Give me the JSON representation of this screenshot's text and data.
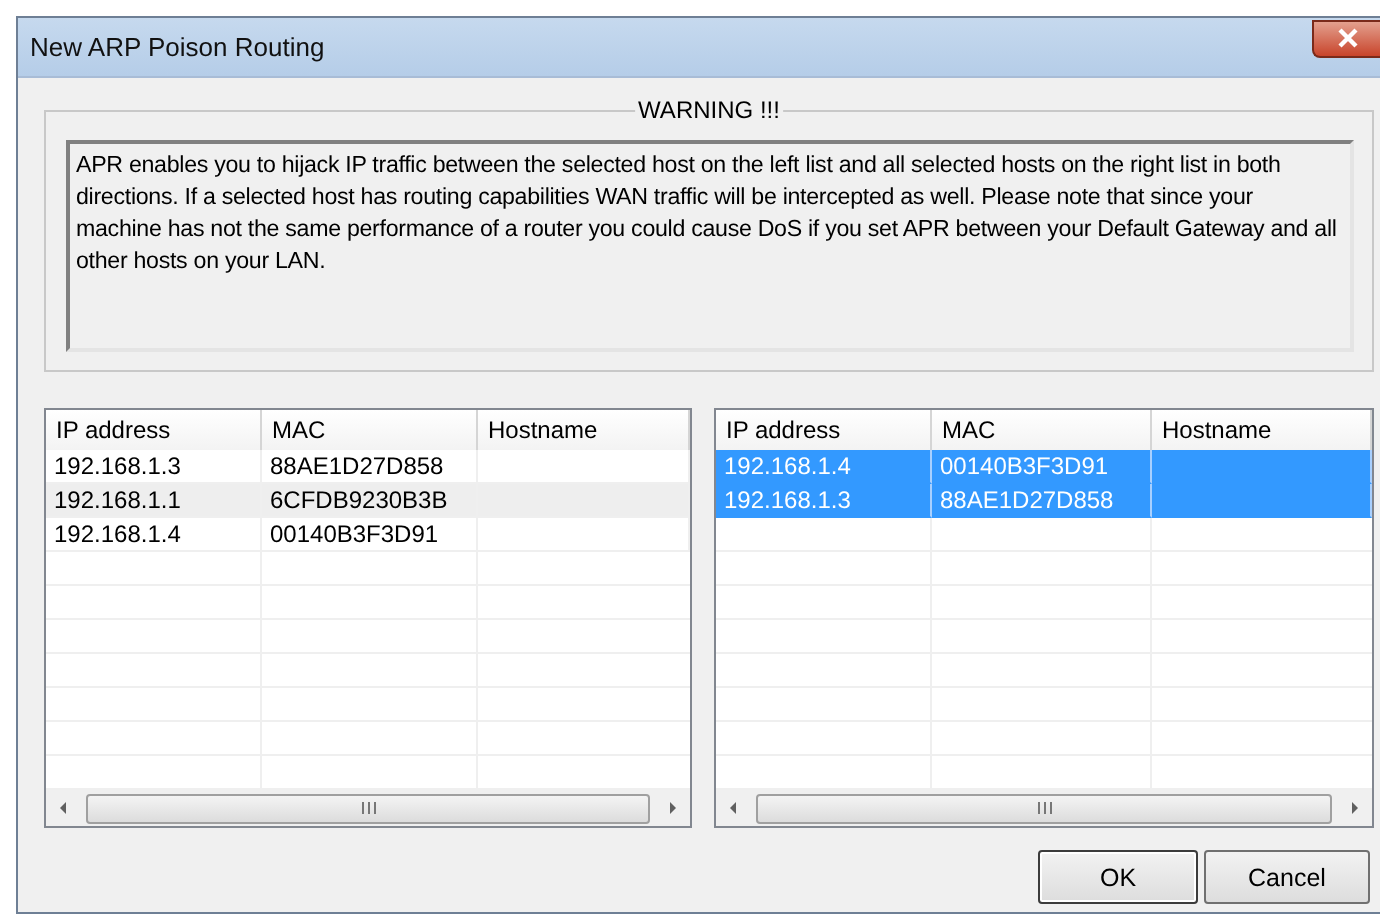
{
  "window": {
    "title": "New ARP Poison Routing"
  },
  "warning": {
    "title": "WARNING !!!",
    "text": "APR enables you to hijack IP traffic between the selected host on the left list and all selected hosts on the right list in both directions. If a selected host has routing capabilities WAN traffic will be intercepted as well. Please note that since your machine has not the same performance of a router you could cause DoS if you set APR between your Default Gateway and all other hosts on your LAN."
  },
  "lists": [
    {
      "focused": false,
      "columns": [
        "IP address",
        "MAC",
        "Hostname"
      ],
      "rows": [
        {
          "ip": "192.168.1.3",
          "mac": "88AE1D27D858",
          "selected": false
        },
        {
          "ip": "192.168.1.1",
          "mac": "6CFDB9230B3B",
          "selected": true
        },
        {
          "ip": "192.168.1.4",
          "mac": "00140B3F3D91",
          "selected": false
        }
      ]
    },
    {
      "focused": true,
      "columns": [
        "IP address",
        "MAC",
        "Hostname"
      ],
      "rows": [
        {
          "ip": "192.168.1.4",
          "mac": "00140B3F3D91",
          "selected": true
        },
        {
          "ip": "192.168.1.3",
          "mac": "88AE1D27D858",
          "selected": true
        }
      ]
    }
  ],
  "buttons": [
    {
      "label": "OK",
      "default": true
    },
    {
      "label": "Cancel",
      "default": false
    }
  ]
}
